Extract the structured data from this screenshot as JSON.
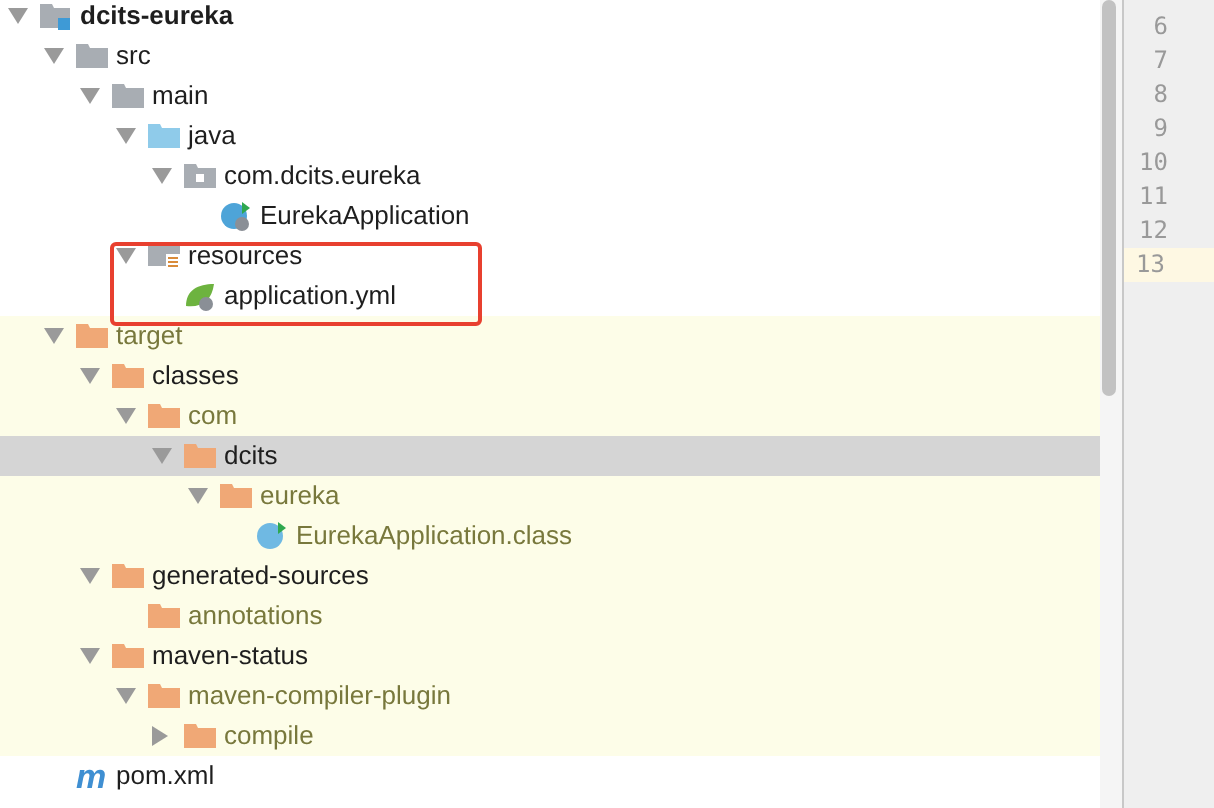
{
  "tree": [
    {
      "label": "dcits-eureka",
      "kind": "module",
      "expanded": true,
      "bold": true,
      "children": [
        {
          "label": "src",
          "kind": "folder",
          "expanded": true,
          "children": [
            {
              "label": "main",
              "kind": "folder",
              "expanded": true,
              "children": [
                {
                  "label": "java",
                  "kind": "source",
                  "expanded": true,
                  "children": [
                    {
                      "label": "com.dcits.eureka",
                      "kind": "package",
                      "expanded": true,
                      "children": [
                        {
                          "label": "EurekaApplication",
                          "kind": "class"
                        }
                      ]
                    }
                  ]
                },
                {
                  "label": "resources",
                  "kind": "resources",
                  "expanded": true,
                  "children": [
                    {
                      "label": "application.yml",
                      "kind": "spring"
                    }
                  ]
                }
              ]
            }
          ]
        },
        {
          "label": "target",
          "kind": "excluded",
          "expanded": true,
          "dimmed": true,
          "children": [
            {
              "label": "classes",
              "kind": "excluded",
              "expanded": true,
              "children": [
                {
                  "label": "com",
                  "kind": "excluded",
                  "expanded": true,
                  "dimmed": true,
                  "children": [
                    {
                      "label": "dcits",
                      "kind": "excluded",
                      "expanded": true,
                      "selected": true,
                      "children": [
                        {
                          "label": "eureka",
                          "kind": "excluded",
                          "expanded": true,
                          "dimmed": true,
                          "children": [
                            {
                              "label": "EurekaApplication.class",
                              "kind": "compiled",
                              "dimmed": true
                            }
                          ]
                        }
                      ]
                    }
                  ]
                }
              ]
            },
            {
              "label": "generated-sources",
              "kind": "excluded",
              "expanded": true,
              "children": [
                {
                  "label": "annotations",
                  "kind": "excluded",
                  "dimmed": true
                }
              ]
            },
            {
              "label": "maven-status",
              "kind": "excluded",
              "expanded": true,
              "children": [
                {
                  "label": "maven-compiler-plugin",
                  "kind": "excluded",
                  "expanded": true,
                  "dimmed": true,
                  "children": [
                    {
                      "label": "compile",
                      "kind": "excluded",
                      "expanded": false,
                      "dimmed": true
                    }
                  ]
                }
              ]
            }
          ]
        },
        {
          "label": "pom.xml",
          "kind": "maven",
          "icon_text": "m"
        }
      ]
    }
  ],
  "line_numbers": [
    {
      "label": "6",
      "current": false
    },
    {
      "label": "7",
      "current": false
    },
    {
      "label": "8",
      "current": false
    },
    {
      "label": "9",
      "current": false
    },
    {
      "label": "10",
      "current": false
    },
    {
      "label": "11",
      "current": false
    },
    {
      "label": "12",
      "current": false
    },
    {
      "label": "13",
      "current": true
    }
  ]
}
